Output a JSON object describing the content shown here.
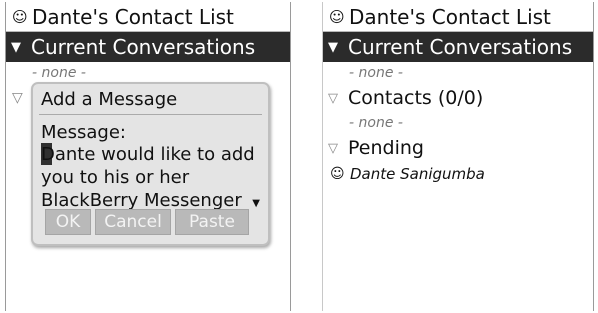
{
  "title": "Dante's Contact List",
  "sections": {
    "current": "Current Conversations",
    "contacts": "Contacts (0/0)",
    "pending": "Pending"
  },
  "none_label": "- none -",
  "pending_contact": "Dante Sanigumba",
  "dialog": {
    "title": "Add a Message",
    "label": "Message:",
    "text": "Dante would like to add you to his or her BlackBerry Messenger",
    "buttons": {
      "ok": "OK",
      "cancel": "Cancel",
      "paste": "Paste"
    }
  },
  "icons": {
    "title": "smiley-icon",
    "chevron": "chevron-down-icon",
    "pending": "contact-icon"
  }
}
